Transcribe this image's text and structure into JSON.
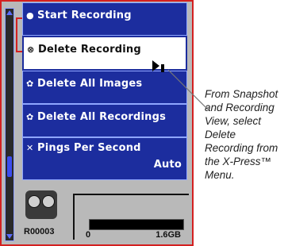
{
  "menu": {
    "items": [
      {
        "icon": "dot-icon",
        "glyph": "●",
        "label": "Start Recording"
      },
      {
        "icon": "delete-recording-icon",
        "glyph": "⊗",
        "label": "Delete Recording"
      },
      {
        "icon": "delete-images-icon",
        "glyph": "✿",
        "label": "Delete All Images"
      },
      {
        "icon": "delete-recordings-icon",
        "glyph": "✿",
        "label": "Delete All Recordings"
      },
      {
        "icon": "pings-icon",
        "glyph": "✕",
        "label": "Pings Per Second",
        "value": "Auto"
      }
    ],
    "selected_index": 1
  },
  "status": {
    "recording_name": "R00003",
    "capacity_min": "0",
    "capacity_max": "1.6GB",
    "capacity_used_fraction": 0.97
  },
  "callout": {
    "text": "From Snapshot and Recording View, select Delete Recording from the X-Press™ Menu."
  },
  "colors": {
    "menu_bg": "#1c2d9e",
    "menu_border": "#8fa6ff",
    "selected_bg": "#ffffff",
    "frame_red": "#d42020",
    "screen_bg": "#b9b9b9"
  }
}
